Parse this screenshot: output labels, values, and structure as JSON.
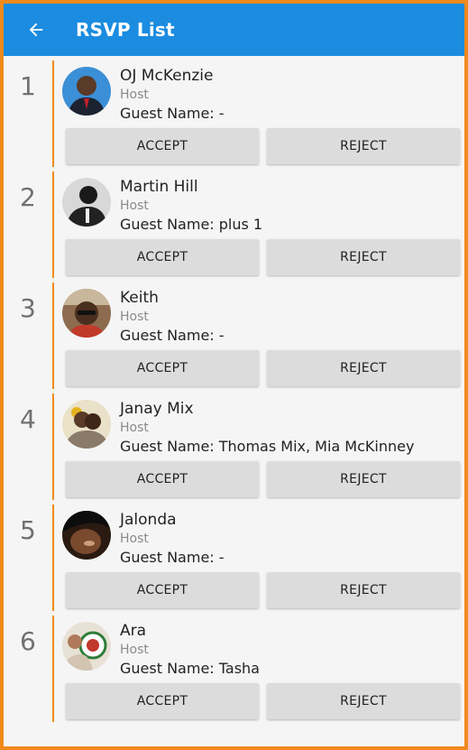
{
  "app": {
    "title": "RSVP List",
    "colors": {
      "appbar": "#1b8ce0",
      "accent": "#f08a1c",
      "button": "#dcdcdc"
    },
    "back_icon": "arrow-left-icon"
  },
  "rsvps": [
    {
      "index": "1",
      "name": "OJ McKenzie",
      "role": "Host",
      "guest": "Guest Name: -",
      "accept": "ACCEPT",
      "reject": "REJECT"
    },
    {
      "index": "2",
      "name": "Martin Hill",
      "role": "Host",
      "guest": "Guest Name: plus 1",
      "accept": "ACCEPT",
      "reject": "REJECT"
    },
    {
      "index": "3",
      "name": "Keith",
      "role": "Host",
      "guest": "Guest Name: -",
      "accept": "ACCEPT",
      "reject": "REJECT"
    },
    {
      "index": "4",
      "name": "Janay Mix",
      "role": "Host",
      "guest": "Guest Name: Thomas Mix, Mia McKinney",
      "accept": "ACCEPT",
      "reject": "REJECT"
    },
    {
      "index": "5",
      "name": "Jalonda",
      "role": "Host",
      "guest": "Guest Name: -",
      "accept": "ACCEPT",
      "reject": "REJECT"
    },
    {
      "index": "6",
      "name": "Ara",
      "role": "Host",
      "guest": "Guest Name: Tasha",
      "accept": "ACCEPT",
      "reject": "REJECT"
    }
  ]
}
